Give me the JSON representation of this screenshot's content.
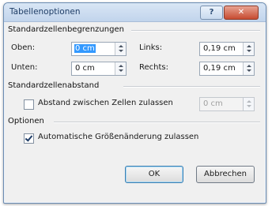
{
  "dialog": {
    "title": "Tabellenoptionen",
    "help_label": "?",
    "close_label": "✕"
  },
  "margins": {
    "heading": "Standardzellenbegrenzungen",
    "top_label": "Oben:",
    "top_value": "0 cm",
    "left_label": "Links:",
    "left_value": "0,19 cm",
    "bottom_label": "Unten:",
    "bottom_value": "0 cm",
    "right_label": "Rechts:",
    "right_value": "0,19 cm"
  },
  "spacing": {
    "heading": "Standardzellenabstand",
    "checkbox_label": "Abstand zwischen Zellen zulassen",
    "checked": false,
    "value": "0 cm"
  },
  "options": {
    "heading": "Optionen",
    "autoresize_label": "Automatische Größenänderung zulassen",
    "checked": true
  },
  "buttons": {
    "ok": "OK",
    "cancel": "Abbrechen"
  }
}
